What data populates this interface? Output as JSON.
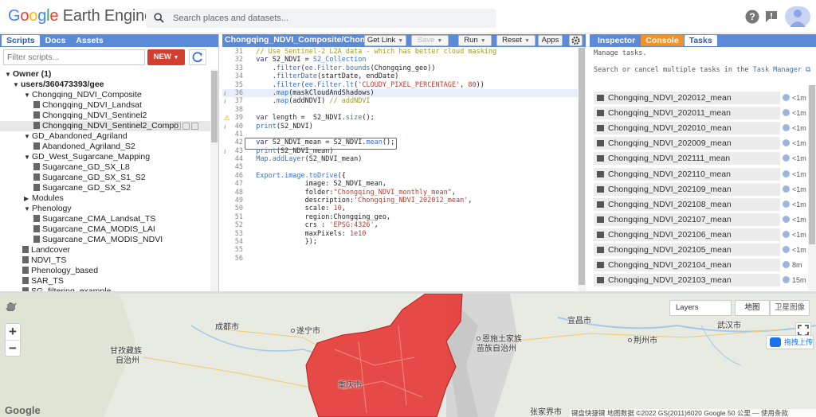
{
  "header": {
    "logo_google": [
      "G",
      "o",
      "o",
      "g",
      "l",
      "e"
    ],
    "logo_rest": "Earth Engine",
    "search_placeholder": "Search places and datasets..."
  },
  "left_panel": {
    "tabs": [
      "Scripts",
      "Docs",
      "Assets"
    ],
    "filter_placeholder": "Filter scripts...",
    "new_label": "NEW",
    "tree": [
      {
        "label": "Owner (1)",
        "arrow": "▼",
        "indent": 6,
        "bold": true
      },
      {
        "label": "users/360473393/gee",
        "arrow": "▼",
        "indent": 16,
        "bold": true
      },
      {
        "label": "Chongqing_NDVI_Composite",
        "arrow": "▼",
        "indent": 30
      },
      {
        "label": "Chongqing_NDVI_Landsat",
        "file": true,
        "indent": 42
      },
      {
        "label": "Chongqing_NDVI_Sentinel2",
        "file": true,
        "indent": 42
      },
      {
        "label": "Chongqing_NDVI_Sentinel2_Compo",
        "file": true,
        "indent": 42,
        "selected": true
      },
      {
        "label": "GD_Abandoned_Agriland",
        "arrow": "▼",
        "indent": 30
      },
      {
        "label": "Abandoned_Agriland_S2",
        "file": true,
        "indent": 42
      },
      {
        "label": "GD_West_Sugarcane_Mapping",
        "arrow": "▼",
        "indent": 30
      },
      {
        "label": "Sugarcane_GD_SX_L8",
        "file": true,
        "indent": 42
      },
      {
        "label": "Sugarcane_GD_SX_S1_S2",
        "file": true,
        "indent": 42
      },
      {
        "label": "Sugarcane_GD_SX_S2",
        "file": true,
        "indent": 42
      },
      {
        "label": "Modules",
        "arrow": "▶",
        "indent": 30
      },
      {
        "label": "Phenology",
        "arrow": "▼",
        "indent": 30
      },
      {
        "label": "Sugarcane_CMA_Landsat_TS",
        "file": true,
        "indent": 42
      },
      {
        "label": "Sugarcane_CMA_MODIS_LAI",
        "file": true,
        "indent": 42
      },
      {
        "label": "Sugarcane_CMA_MODIS_NDVI",
        "file": true,
        "indent": 42
      },
      {
        "label": "Landcover",
        "file": true,
        "indent": 28
      },
      {
        "label": "NDVI_TS",
        "file": true,
        "indent": 28
      },
      {
        "label": "Phenology_based",
        "file": true,
        "indent": 28
      },
      {
        "label": "SAR_TS",
        "file": true,
        "indent": 28
      },
      {
        "label": "SG_filtering_example",
        "file": true,
        "indent": 28
      }
    ]
  },
  "editor": {
    "title": "Chongqing_NDVI_Composite/Chongqi...",
    "buttons": {
      "get_link": "Get Link",
      "save": "Save",
      "run": "Run",
      "reset": "Reset",
      "apps": "Apps"
    },
    "lines": [
      {
        "n": "31",
        "html": "  <span class='cm'>// Use Sentinel-2 L2A data - which has better cloud masking</span>"
      },
      {
        "n": "32",
        "html": "  <span class='kw'>var</span> S2_NDVI = <span class='fn'>S2_Collection</span>"
      },
      {
        "n": "33",
        "html": "      .<span class='fn'>filter</span>(<span class='fn'>ee.Filter.bounds</span>(Chongqing_geo))"
      },
      {
        "n": "34",
        "html": "      .<span class='fn'>filterDate</span>(startDate, endDate)"
      },
      {
        "n": "35",
        "html": "      .<span class='fn'>filter</span>(<span class='fn'>ee.Filter.lt</span>(<span class='st'>'CLOUDY_PIXEL_PERCENTAGE'</span>, <span class='nu'>80</span>))"
      },
      {
        "n": "36",
        "html": "      .<span class='fn'>map</span>(maskCloudAndShadows)",
        "hl": true,
        "gut": "i"
      },
      {
        "n": "37",
        "html": "      .<span class='fn'>map</span>(addNDVI) <span class='cm'>// addNDVI</span>",
        "gut": "i"
      },
      {
        "n": "38",
        "html": ""
      },
      {
        "n": "39",
        "html": "  <span class='kw'>var</span> length =  S2_NDVI.<span class='fn'>size</span>();",
        "gut": "w"
      },
      {
        "n": "40",
        "html": "  <span class='fn'>print</span>(S2_NDVI)",
        "gut": "i"
      },
      {
        "n": "41",
        "html": ""
      },
      {
        "n": "42",
        "html": "  <span class='kw'>var</span> S2_NDVI_mean = S2_NDVI.<span class='fn'>mean</span>();"
      },
      {
        "n": "43",
        "html": "  <span class='fn'>print</span>(S2_NDVI_mean)",
        "gut": "i"
      },
      {
        "n": "44",
        "html": "  <span class='fn'>Map.addLayer</span>(S2_NDVI_mean)"
      },
      {
        "n": "45",
        "html": ""
      },
      {
        "n": "46",
        "html": "  <span class='fn'>Export.image.toDrive</span>({"
      },
      {
        "n": "47",
        "html": "              image: S2_NDVI_mean,"
      },
      {
        "n": "48",
        "html": "              folder:<span class='st'>\"Chongqing_NDVI_monthly_mean\"</span>,"
      },
      {
        "n": "49",
        "html": "              description:<span class='st'>'Chongqing_NDVI_202012_mean'</span>,"
      },
      {
        "n": "50",
        "html": "              scale: <span class='nu'>10</span>,"
      },
      {
        "n": "51",
        "html": "              region:Chongqing_geo,"
      },
      {
        "n": "52",
        "html": "              crs : <span class='st'>'EPSG:4326'</span>,"
      },
      {
        "n": "53",
        "html": "              maxPixels: <span class='nu'>1e10</span>"
      },
      {
        "n": "54",
        "html": "              });"
      },
      {
        "n": "55",
        "html": ""
      },
      {
        "n": "56",
        "html": ""
      }
    ]
  },
  "right_panel": {
    "tabs": [
      "Inspector",
      "Console",
      "Tasks"
    ],
    "msg1": "Manage tasks.",
    "msg2": "Search or cancel multiple tasks in the",
    "msg2_link": "Task Manager",
    "tasks": [
      {
        "name": "Chongqing_NDVI_202012_mean",
        "time": "<1m"
      },
      {
        "name": "Chongqing_NDVI_202011_mean",
        "time": "<1m"
      },
      {
        "name": "Chongqing_NDVI_202010_mean",
        "time": "<1m"
      },
      {
        "name": "Chongqing_NDVI_202009_mean",
        "time": "<1m"
      },
      {
        "name": "Chongqing_NDVI_202111_mean",
        "time": "<1m"
      },
      {
        "name": "Chongqing_NDVI_202110_mean",
        "time": "<1m"
      },
      {
        "name": "Chongqing_NDVI_202109_mean",
        "time": "<1m"
      },
      {
        "name": "Chongqing_NDVI_202108_mean",
        "time": "<1m"
      },
      {
        "name": "Chongqing_NDVI_202107_mean",
        "time": "<1m"
      },
      {
        "name": "Chongqing_NDVI_202106_mean",
        "time": "<1m"
      },
      {
        "name": "Chongqing_NDVI_202105_mean",
        "time": "<1m"
      },
      {
        "name": "Chongqing_NDVI_202104_mean",
        "time": "8m"
      },
      {
        "name": "Chongqing_NDVI_202103_mean",
        "time": "15m"
      }
    ]
  },
  "map": {
    "layers_label": "Layers",
    "map_type": "地图",
    "satellite_type": "卫星图像",
    "ext_button": "拖拽上传",
    "google_mark": "Google",
    "attribution": "键盘快捷键  地图数据 ©2022 GS(2011)6020 Google   50 公里 ⎯⎯   使用条款",
    "cities": [
      {
        "name": "成都市",
        "cls": "c1"
      },
      {
        "name": "遂宁市",
        "cls": "c2"
      },
      {
        "name": "甘孜藏族",
        "cls": "c3"
      },
      {
        "name": "自治州",
        "cls": "c4"
      },
      {
        "name": "恩施土家族",
        "cls": "c5"
      },
      {
        "name": "苗族自治州",
        "cls": "c6"
      },
      {
        "name": "宜昌市",
        "cls": "c7"
      },
      {
        "name": "荆州市",
        "cls": "c8"
      },
      {
        "name": "武汉市",
        "cls": "c9"
      },
      {
        "name": "重庆市",
        "cls": "c10"
      },
      {
        "name": "张家界市",
        "cls": "c11"
      }
    ]
  }
}
